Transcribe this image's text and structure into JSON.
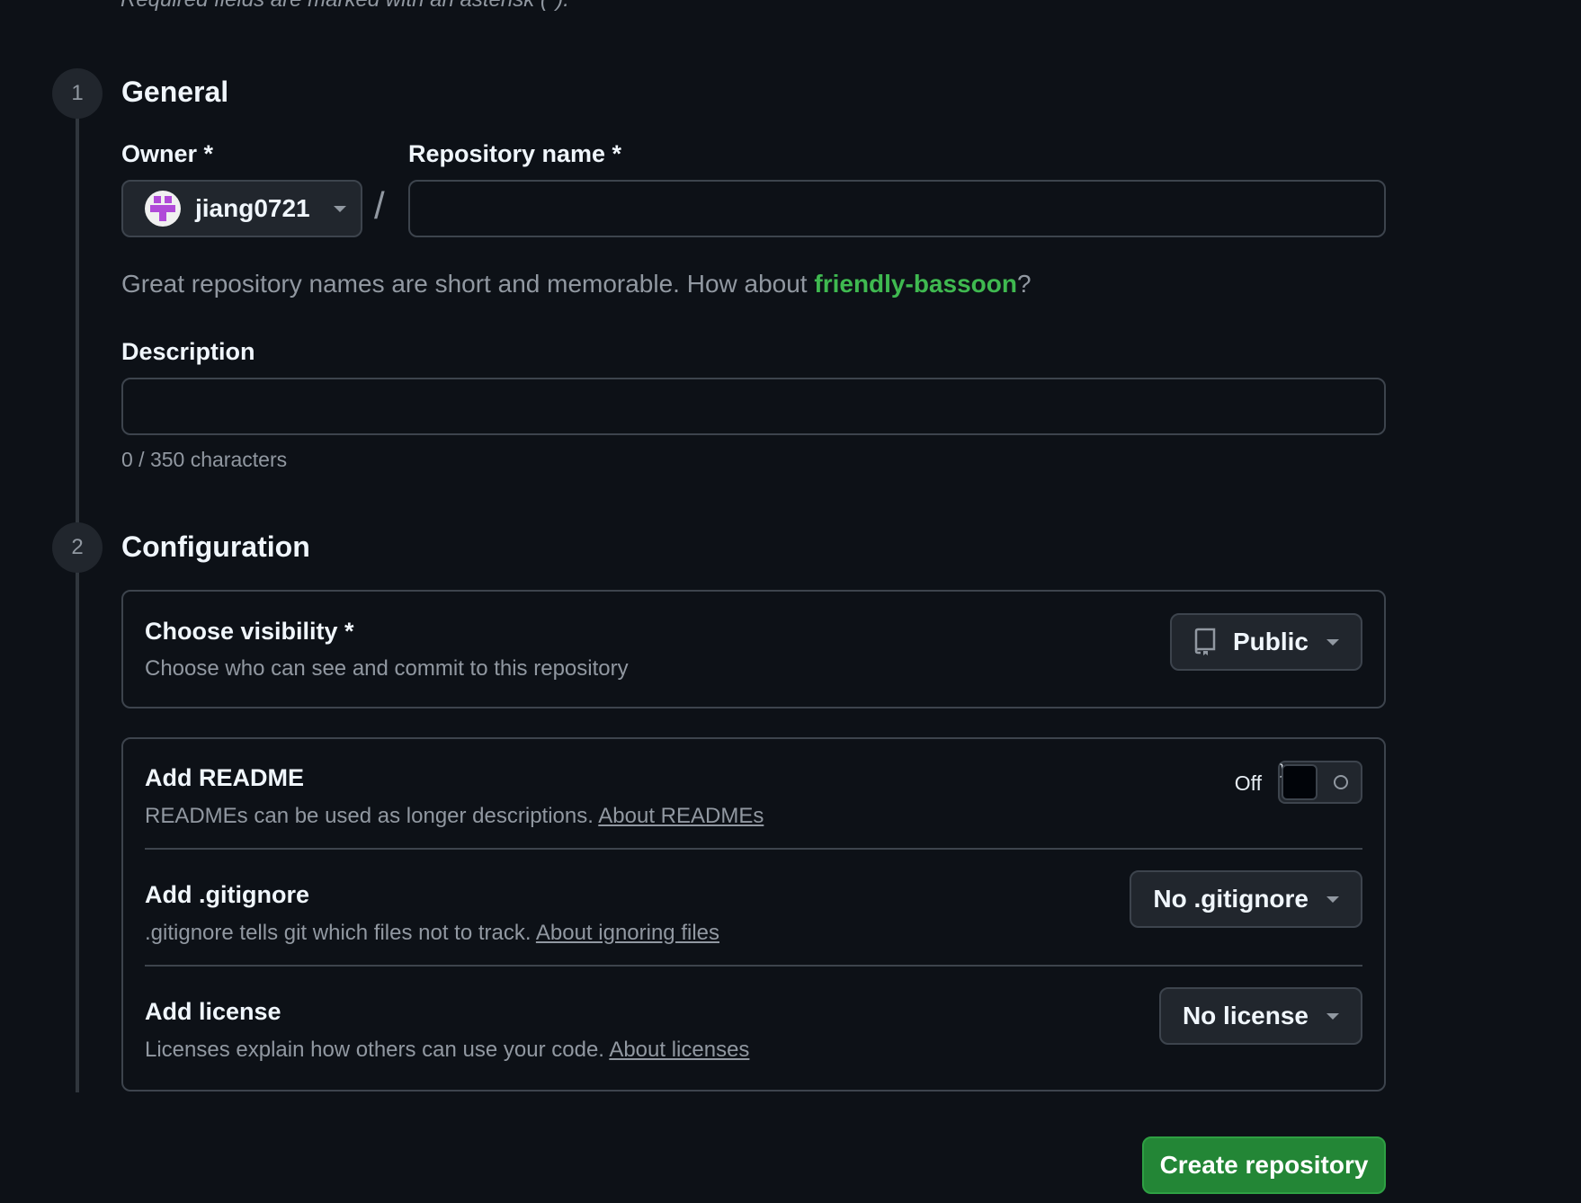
{
  "top_note": "Required fields are marked with an asterisk (*).",
  "steps": {
    "general": {
      "number": "1",
      "title": "General"
    },
    "configuration": {
      "number": "2",
      "title": "Configuration"
    }
  },
  "owner": {
    "label": "Owner *",
    "value": "jiang0721"
  },
  "repo_name": {
    "label": "Repository name *",
    "value": "",
    "separator": "/"
  },
  "name_hint": {
    "prefix": "Great repository names are short and memorable. How about ",
    "suggestion": "friendly-bassoon",
    "suffix": "?"
  },
  "description": {
    "label": "Description",
    "value": "",
    "count": "0 / 350 characters"
  },
  "visibility": {
    "title": "Choose visibility *",
    "desc": "Choose who can see and commit to this repository",
    "selected": "Public"
  },
  "readme": {
    "title": "Add README",
    "desc": "READMEs can be used as longer descriptions. ",
    "link": "About READMEs",
    "toggle_label": "Off",
    "enabled": false
  },
  "gitignore": {
    "title": "Add .gitignore",
    "desc": ".gitignore tells git which files not to track. ",
    "link": "About ignoring files",
    "selected": "No .gitignore"
  },
  "license": {
    "title": "Add license",
    "desc": "Licenses explain how others can use your code. ",
    "link": "About licenses",
    "selected": "No license"
  },
  "create_button": "Create repository",
  "colors": {
    "background": "#0d1117",
    "accent_green": "#238636",
    "suggestion_green": "#3fb950",
    "border": "#3d444d"
  },
  "icons": [
    "chevron-down-icon",
    "repo-icon",
    "avatar-identicon",
    "toggle-off-icon"
  ]
}
